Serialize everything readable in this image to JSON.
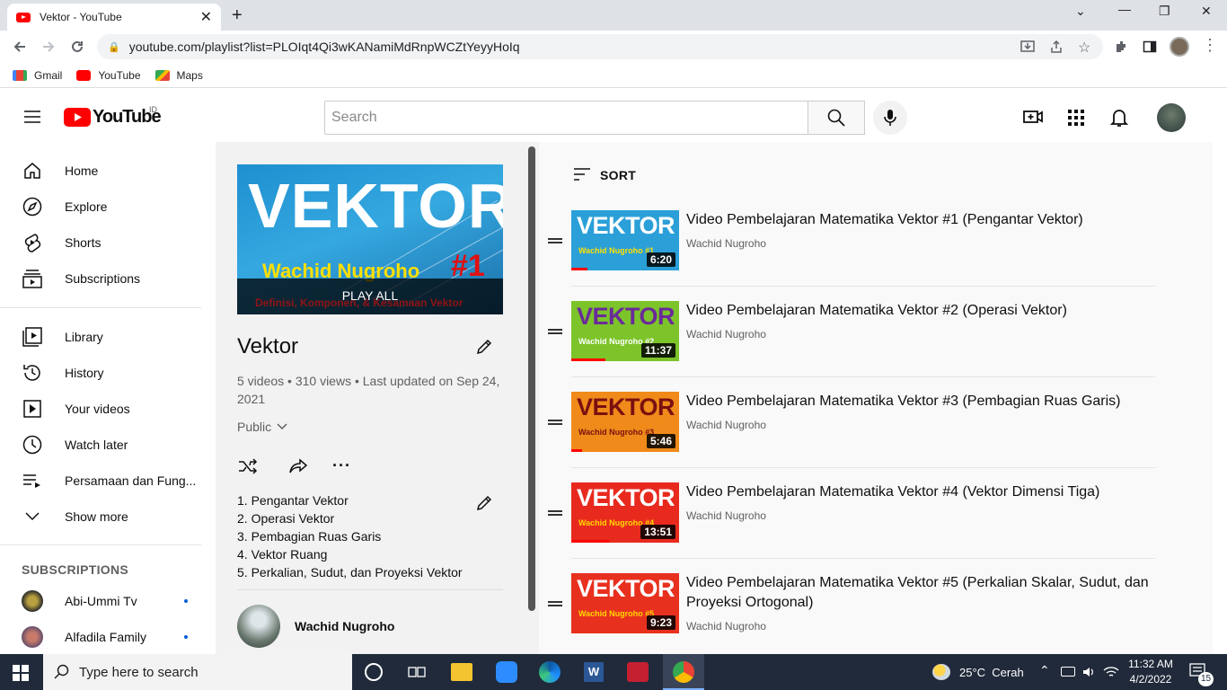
{
  "browser": {
    "tab_title": "Vektor - YouTube",
    "url": "youtube.com/playlist?list=PLOIqt4Qi3wKANamiMdRnpWCZtYeyyHoIq",
    "bookmarks": [
      "Gmail",
      "YouTube",
      "Maps"
    ]
  },
  "header": {
    "logo_text": "YouTube",
    "country": "ID",
    "search_placeholder": "Search"
  },
  "sidebar": {
    "items": [
      {
        "label": "Home",
        "icon": "home-icon"
      },
      {
        "label": "Explore",
        "icon": "compass-icon"
      },
      {
        "label": "Shorts",
        "icon": "shorts-icon"
      },
      {
        "label": "Subscriptions",
        "icon": "subscriptions-icon"
      },
      {
        "label": "Library",
        "icon": "library-icon"
      },
      {
        "label": "History",
        "icon": "history-icon"
      },
      {
        "label": "Your videos",
        "icon": "your-videos-icon"
      },
      {
        "label": "Watch later",
        "icon": "clock-icon"
      },
      {
        "label": "Persamaan dan Fung...",
        "icon": "playlist-icon"
      },
      {
        "label": "Show more",
        "icon": "chevron-down-icon"
      }
    ],
    "subscriptions_heading": "SUBSCRIPTIONS",
    "subscriptions": [
      "Abi-Ummi Tv",
      "Alfadila Family"
    ]
  },
  "playlist": {
    "thumb_title": "VEKTOR",
    "thumb_author": "Wachid Nugroho",
    "thumb_number": "#1",
    "thumb_subtitle": "Definisi, Komponen, & Kesamaan Vektor",
    "play_all": "PLAY ALL",
    "title": "Vektor",
    "stats": "5 videos • 310 views • Last updated on Sep 24, 2021",
    "privacy": "Public",
    "description": [
      "1. Pengantar Vektor",
      "2. Operasi Vektor",
      "3. Pembagian Ruas Garis",
      "4. Vektor Ruang",
      "5. Perkalian, Sudut, dan Proyeksi Vektor"
    ],
    "owner": "Wachid Nugroho"
  },
  "sort_label": "SORT",
  "videos": [
    {
      "title": "Video Pembelajaran Matematika Vektor #1 (Pengantar Vektor)",
      "channel": "Wachid Nugroho",
      "duration": "6:20",
      "thumb_text": "VEKTOR",
      "thumb_sub": "Wachid Nugroho #1",
      "bg": "#2b9fd8",
      "txt": "#ffffff",
      "sub": "#ffe000",
      "progress": 0.15
    },
    {
      "title": "Video Pembelajaran Matematika Vektor #2 (Operasi Vektor)",
      "channel": "Wachid Nugroho",
      "duration": "11:37",
      "thumb_text": "VEKTOR",
      "thumb_sub": "Wachid Nugroho #2",
      "bg": "#7cc42a",
      "txt": "#6a2a9a",
      "sub": "#ffffff",
      "progress": 0.32
    },
    {
      "title": "Video Pembelajaran Matematika Vektor #3 (Pembagian Ruas Garis)",
      "channel": "Wachid Nugroho",
      "duration": "5:46",
      "thumb_text": "VEKTOR",
      "thumb_sub": "Wachid Nugroho #3",
      "bg": "#f08a1a",
      "txt": "#7a1010",
      "sub": "#7a1010",
      "progress": 0.1
    },
    {
      "title": "Video Pembelajaran Matematika Vektor #4 (Vektor Dimensi Tiga)",
      "channel": "Wachid Nugroho",
      "duration": "13:51",
      "thumb_text": "VEKTOR",
      "thumb_sub": "Wachid Nugroho #4",
      "bg": "#e82a1e",
      "txt": "#ffffff",
      "sub": "#ffd800",
      "progress": 0.35
    },
    {
      "title": "Video Pembelajaran Matematika Vektor #5 (Perkalian Skalar, Sudut, dan Proyeksi Ortogonal)",
      "channel": "Wachid Nugroho",
      "duration": "9:23",
      "thumb_text": "VEKTOR",
      "thumb_sub": "Wachid Nugroho #5",
      "bg": "#e8301e",
      "txt": "#ffffff",
      "sub": "#ffd800",
      "progress": 0.0
    }
  ],
  "taskbar": {
    "search_placeholder": "Type here to search",
    "weather": "25°C  Cerah",
    "time": "11:32 AM",
    "date": "4/2/2022",
    "notifications": "15"
  }
}
